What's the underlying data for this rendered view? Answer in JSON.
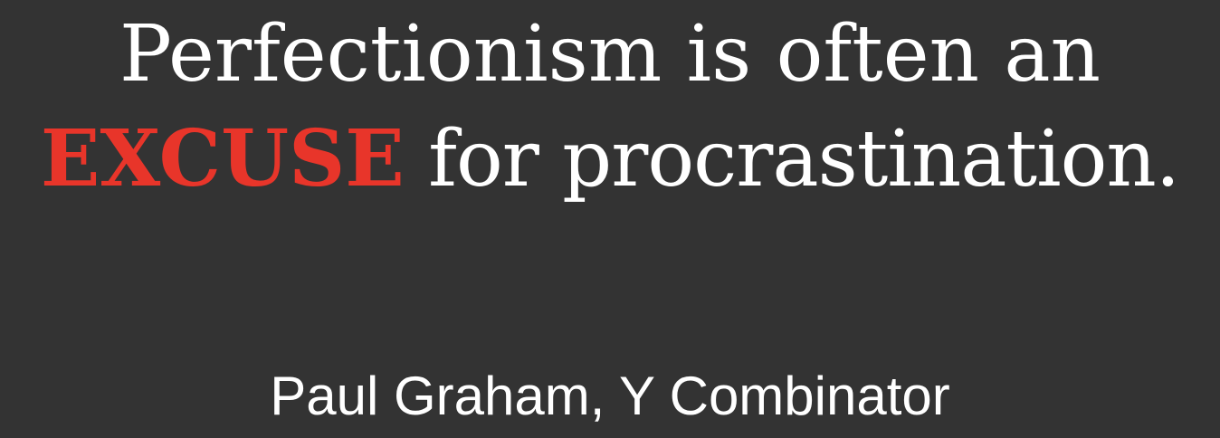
{
  "quote": {
    "line1": "Perfectionism is often an",
    "emphasis": "EXCUSE",
    "line2_rest": " for procrastination."
  },
  "attribution": "Paul Graham, Y Combinator",
  "colors": {
    "background": "#333333",
    "text": "#ffffff",
    "emphasis": "#e8352a"
  }
}
